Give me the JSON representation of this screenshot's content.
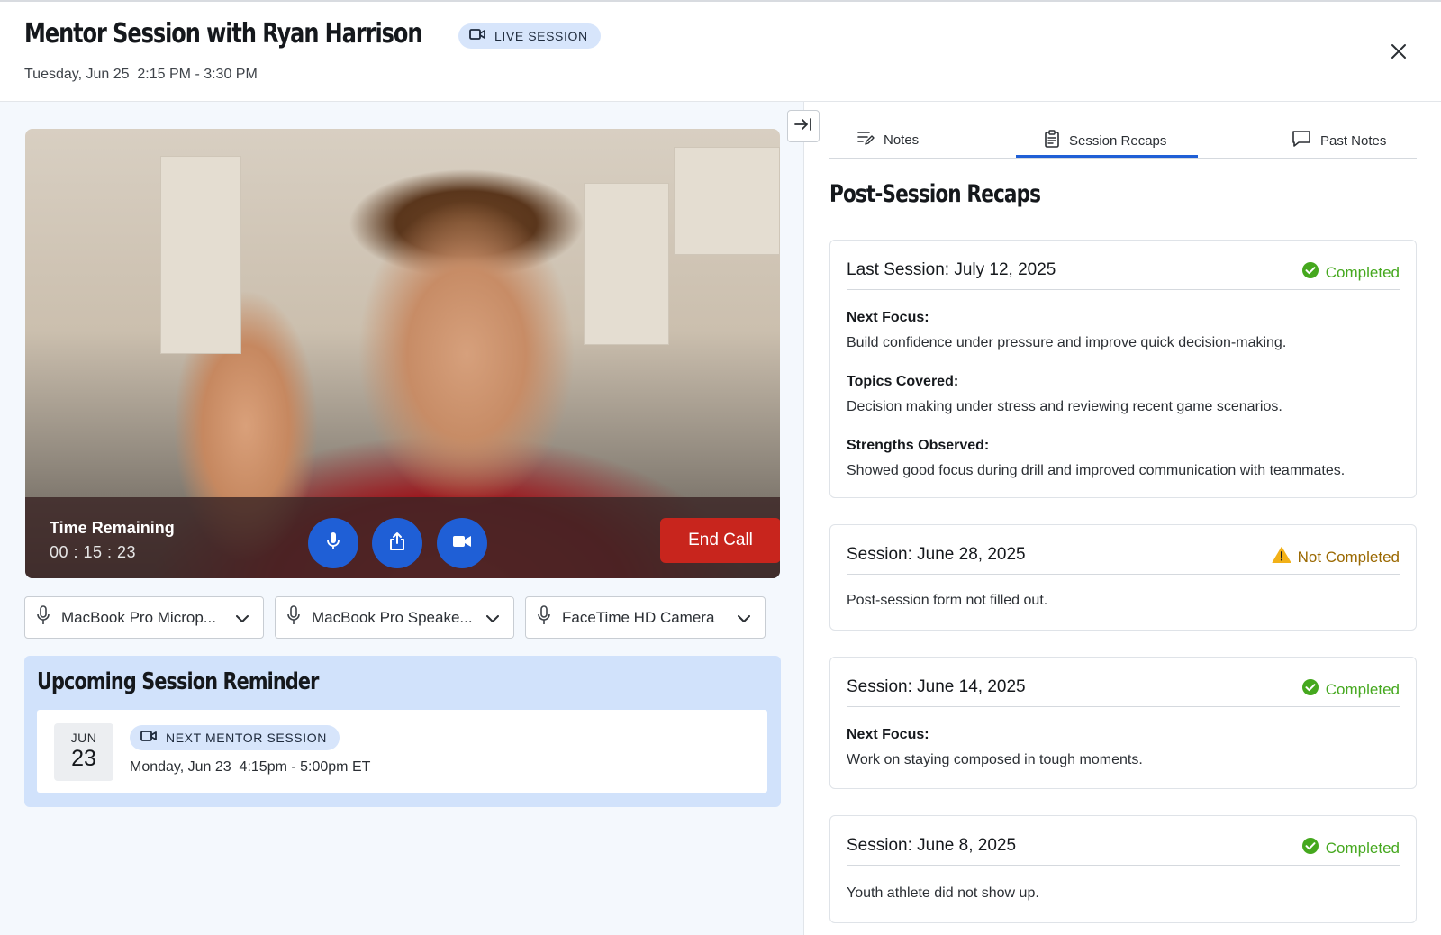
{
  "header": {
    "title": "Mentor Session with Ryan Harrison",
    "badge": "LIVE SESSION",
    "datetime": "Tuesday, Jun 25  2:15 PM - 3:30 PM"
  },
  "call": {
    "time_label": "Time Remaining",
    "time_value": "00 : 15 : 23",
    "end_call": "End Call"
  },
  "devices": [
    {
      "label": "MacBook Pro Microp...",
      "icon": "microphone-icon"
    },
    {
      "label": "MacBook Pro Speake...",
      "icon": "microphone-icon"
    },
    {
      "label": "FaceTime HD Camera",
      "icon": "microphone-icon"
    }
  ],
  "reminder": {
    "title": "Upcoming Session Reminder",
    "month": "JUN",
    "day": "23",
    "badge": "NEXT MENTOR SESSION",
    "time": "Monday, Jun 23  4:15pm - 5:00pm ET"
  },
  "tabs": [
    {
      "label": "Notes",
      "icon": "notes-edit-icon"
    },
    {
      "label": "Session Recaps",
      "icon": "clipboard-icon",
      "active": true
    },
    {
      "label": "Past Notes",
      "icon": "chat-bubble-icon"
    }
  ],
  "recaps_title": "Post-Session Recaps",
  "recaps": [
    {
      "heading": "Last Session: July 12, 2025",
      "status": "Completed",
      "fields": [
        {
          "label": "Next Focus:",
          "value": "Build confidence under pressure and improve quick decision-making."
        },
        {
          "label": "Topics Covered:",
          "value": "Decision making under stress and reviewing recent game scenarios."
        },
        {
          "label": "Strengths Observed:",
          "value": "Showed good focus during drill and improved communication with teammates."
        }
      ]
    },
    {
      "heading": "Session: June 28, 2025",
      "status": "Not Completed",
      "note": "Post-session form not filled out."
    },
    {
      "heading": "Session: June 14, 2025",
      "status": "Completed",
      "fields": [
        {
          "label": "Next Focus:",
          "value": "Work on staying composed in tough moments."
        }
      ]
    },
    {
      "heading": "Session: June 8, 2025",
      "status": "Completed",
      "note": "Youth athlete did not show up."
    }
  ],
  "colors": {
    "accent": "#1f5fd6",
    "end_call": "#c8251d",
    "completed": "#45a81e",
    "warning": "#f2b118",
    "badge_bg": "#d7e5fb"
  }
}
